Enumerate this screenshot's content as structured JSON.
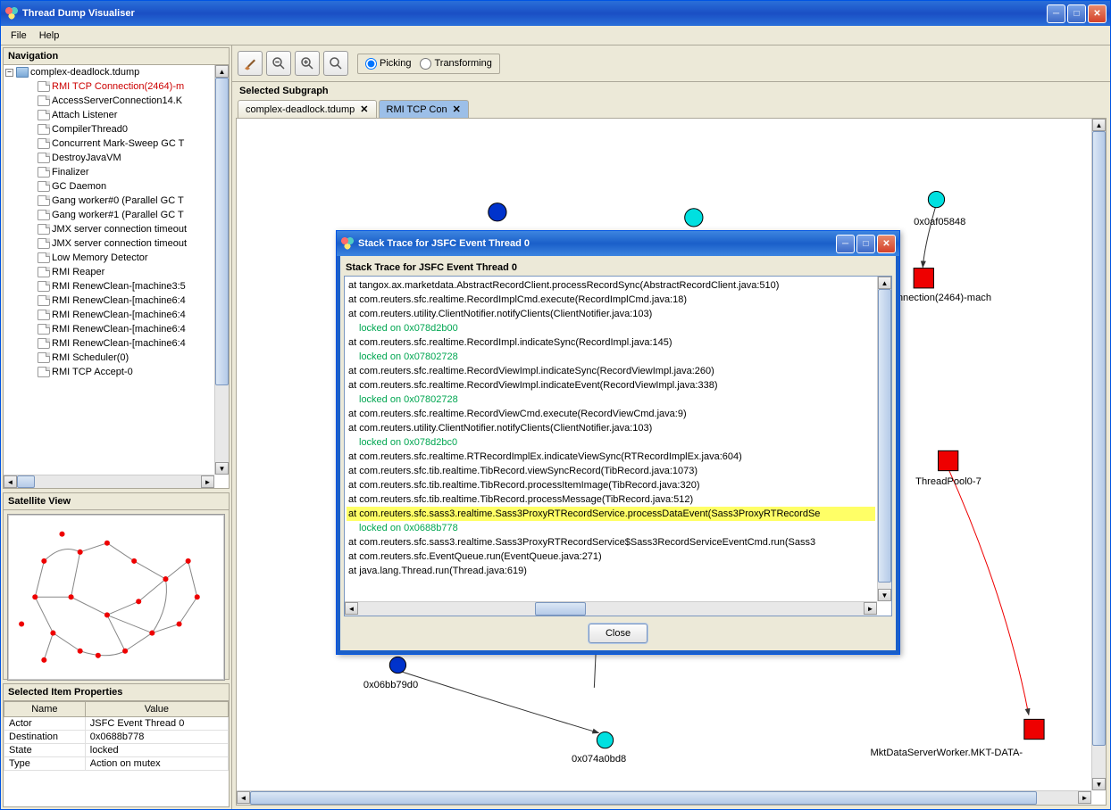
{
  "window": {
    "title": "Thread Dump Visualiser"
  },
  "menubar": {
    "file": "File",
    "help": "Help"
  },
  "navigation": {
    "header": "Navigation",
    "root": "complex-deadlock.tdump",
    "items": [
      "RMI TCP Connection(2464)-m",
      "AccessServerConnection14.K",
      "Attach Listener",
      "CompilerThread0",
      "Concurrent Mark-Sweep GC T",
      "DestroyJavaVM",
      "Finalizer",
      "GC Daemon",
      "Gang worker#0 (Parallel GC T",
      "Gang worker#1 (Parallel GC T",
      "JMX server connection timeout",
      "JMX server connection timeout",
      "Low Memory Detector",
      "RMI Reaper",
      "RMI RenewClean-[machine3:5",
      "RMI RenewClean-[machine6:4",
      "RMI RenewClean-[machine6:4",
      "RMI RenewClean-[machine6:4",
      "RMI RenewClean-[machine6:4",
      "RMI Scheduler(0)",
      "RMI TCP Accept-0"
    ]
  },
  "satellite": {
    "header": "Satellite View"
  },
  "properties": {
    "header": "Selected Item Properties",
    "cols": {
      "name": "Name",
      "value": "Value"
    },
    "rows": [
      {
        "name": "Actor",
        "value": "JSFC Event Thread 0"
      },
      {
        "name": "Destination",
        "value": "0x0688b778"
      },
      {
        "name": "State",
        "value": "locked"
      },
      {
        "name": "Type",
        "value": "Action on mutex"
      }
    ]
  },
  "toolbar": {
    "modes": {
      "picking": "Picking",
      "transforming": "Transforming"
    }
  },
  "subgraph": {
    "label": "Selected Subgraph",
    "tabs": [
      {
        "label": "complex-deadlock.tdump",
        "active": false
      },
      {
        "label": "RMI TCP Con",
        "active": true
      }
    ]
  },
  "graph": {
    "nodes": [
      {
        "id": "0x0af05848",
        "label": "0x0af05848"
      },
      {
        "id": "conn2464",
        "label": "nnection(2464)-mach"
      },
      {
        "id": "threadpool",
        "label": "ThreadPool0-7"
      },
      {
        "id": "mktdata",
        "label": "MktDataServerWorker.MKT-DATA-"
      },
      {
        "id": "0x06bb79d0",
        "label": "0x06bb79d0"
      },
      {
        "id": "0x074a0bd8",
        "label": "0x074a0bd8"
      }
    ]
  },
  "dialog": {
    "title": "Stack Trace for JSFC Event Thread 0",
    "label": "Stack Trace for JSFC Event Thread 0",
    "close": "Close",
    "lines": [
      {
        "t": "at tangox.ax.marketdata.AbstractRecordClient.processRecordSync(AbstractRecordClient.java:510)",
        "cls": ""
      },
      {
        "t": "at com.reuters.sfc.realtime.RecordImplCmd.execute(RecordImplCmd.java:18)",
        "cls": ""
      },
      {
        "t": "at com.reuters.utility.ClientNotifier.notifyClients(ClientNotifier.java:103)",
        "cls": ""
      },
      {
        "t": "locked on 0x078d2b00",
        "cls": "lock"
      },
      {
        "t": "at com.reuters.sfc.realtime.RecordImpl.indicateSync(RecordImpl.java:145)",
        "cls": ""
      },
      {
        "t": "locked on 0x07802728",
        "cls": "lock"
      },
      {
        "t": "at com.reuters.sfc.realtime.RecordViewImpl.indicateSync(RecordViewImpl.java:260)",
        "cls": ""
      },
      {
        "t": "at com.reuters.sfc.realtime.RecordViewImpl.indicateEvent(RecordViewImpl.java:338)",
        "cls": ""
      },
      {
        "t": "locked on 0x07802728",
        "cls": "lock"
      },
      {
        "t": "at com.reuters.sfc.realtime.RecordViewCmd.execute(RecordViewCmd.java:9)",
        "cls": ""
      },
      {
        "t": "at com.reuters.utility.ClientNotifier.notifyClients(ClientNotifier.java:103)",
        "cls": ""
      },
      {
        "t": "locked on 0x078d2bc0",
        "cls": "lock"
      },
      {
        "t": "at com.reuters.sfc.realtime.RTRecordImplEx.indicateViewSync(RTRecordImplEx.java:604)",
        "cls": ""
      },
      {
        "t": "at com.reuters.sfc.tib.realtime.TibRecord.viewSyncRecord(TibRecord.java:1073)",
        "cls": ""
      },
      {
        "t": "at com.reuters.sfc.tib.realtime.TibRecord.processItemImage(TibRecord.java:320)",
        "cls": ""
      },
      {
        "t": "at com.reuters.sfc.tib.realtime.TibRecord.processMessage(TibRecord.java:512)",
        "cls": ""
      },
      {
        "t": "at com.reuters.sfc.sass3.realtime.Sass3ProxyRTRecordService.processDataEvent(Sass3ProxyRTRecordSe",
        "cls": "hl"
      },
      {
        "t": "locked on 0x0688b778",
        "cls": "lock"
      },
      {
        "t": "at com.reuters.sfc.sass3.realtime.Sass3ProxyRTRecordService$Sass3RecordServiceEventCmd.run(Sass3",
        "cls": ""
      },
      {
        "t": "at com.reuters.sfc.EventQueue.run(EventQueue.java:271)",
        "cls": ""
      },
      {
        "t": "at java.lang.Thread.run(Thread.java:619)",
        "cls": ""
      }
    ]
  }
}
